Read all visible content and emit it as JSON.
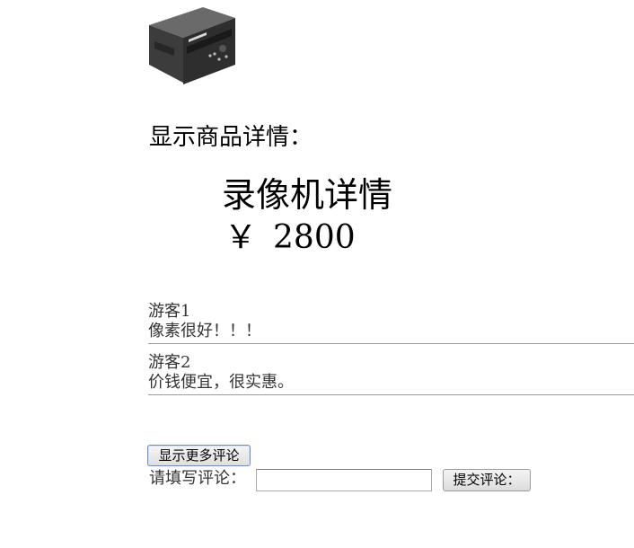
{
  "product": {
    "section_title": "显示商品详情：",
    "name": "录像机详情",
    "currency_symbol": "￥",
    "price": "2800",
    "image_icon": "vcr-device-image"
  },
  "comments": [
    {
      "user": "游客1",
      "text": "像素很好！！！"
    },
    {
      "user": "游客2",
      "text": "价钱便宜，很实惠。"
    }
  ],
  "actions": {
    "show_more_label": "显示更多评论",
    "comment_label": "请填写评论：",
    "comment_value": "",
    "submit_label": "提交评论："
  },
  "colors": {
    "divider": "#9a9a9a",
    "comment_text": "#333333",
    "button_border_focus": "#6f8cc6"
  }
}
